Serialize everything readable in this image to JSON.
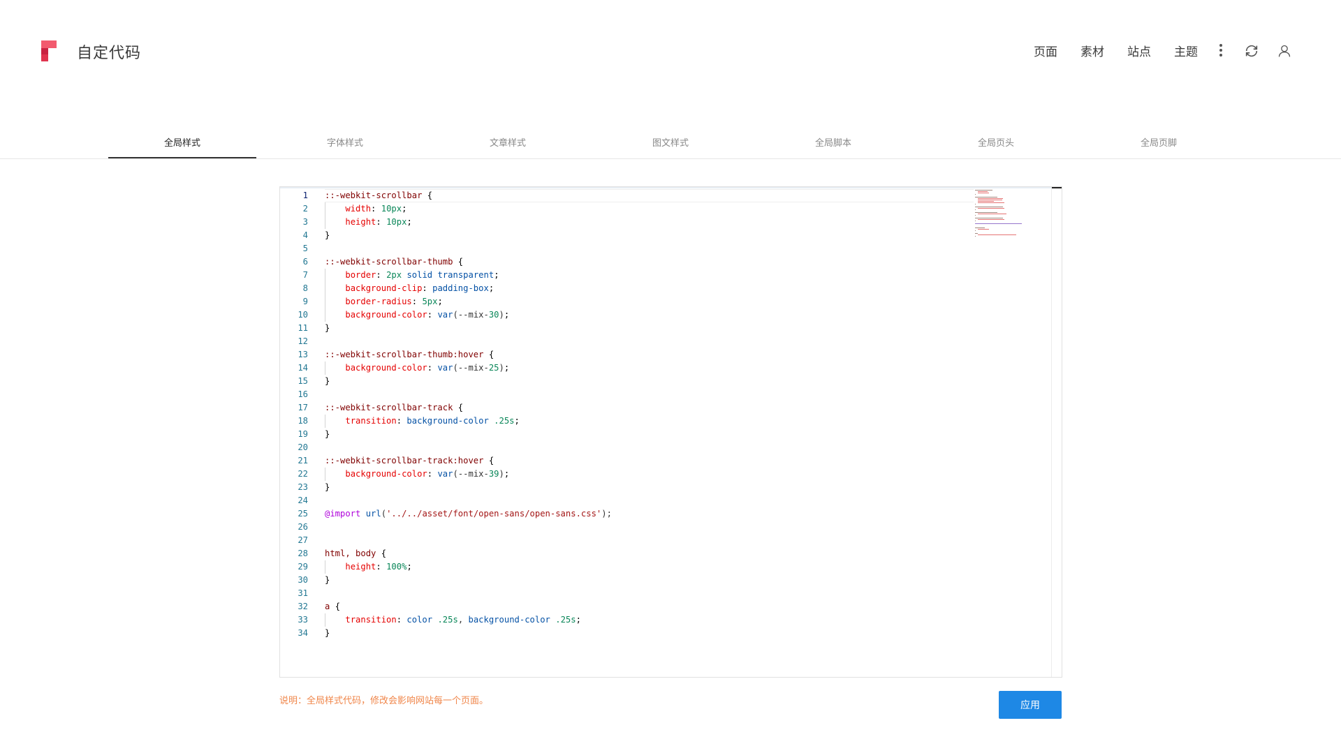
{
  "header": {
    "app_title": "自定代码",
    "nav": [
      "页面",
      "素材",
      "站点",
      "主题"
    ],
    "icons": [
      "more-vertical-icon",
      "refresh-icon",
      "user-icon"
    ]
  },
  "tabs": [
    {
      "label": "全局样式",
      "active": true
    },
    {
      "label": "字体样式",
      "active": false
    },
    {
      "label": "文章样式",
      "active": false
    },
    {
      "label": "图文样式",
      "active": false
    },
    {
      "label": "全局脚本",
      "active": false
    },
    {
      "label": "全局页头",
      "active": false
    },
    {
      "label": "全局页脚",
      "active": false
    }
  ],
  "editor": {
    "current_line": 1,
    "lines": [
      "::-webkit-scrollbar {",
      "    width: 10px;",
      "    height: 10px;",
      "}",
      "",
      "::-webkit-scrollbar-thumb {",
      "    border: 2px solid transparent;",
      "    background-clip: padding-box;",
      "    border-radius: 5px;",
      "    background-color: var(--mix-30);",
      "}",
      "",
      "::-webkit-scrollbar-thumb:hover {",
      "    background-color: var(--mix-25);",
      "}",
      "",
      "::-webkit-scrollbar-track {",
      "    transition: background-color .25s;",
      "}",
      "",
      "::-webkit-scrollbar-track:hover {",
      "    background-color: var(--mix-39);",
      "}",
      "",
      "@import url('../../asset/font/open-sans/open-sans.css');",
      "",
      "",
      "html, body {",
      "    height: 100%;",
      "}",
      "",
      "a {",
      "    transition: color .25s, background-color .25s;",
      "}"
    ]
  },
  "footer": {
    "note": "说明：全局样式代码，修改会影响网站每一个页面。",
    "apply_label": "应用"
  },
  "colors": {
    "accent": "#1e88e5",
    "note": "#f0864a",
    "logo": "#e0344f"
  }
}
